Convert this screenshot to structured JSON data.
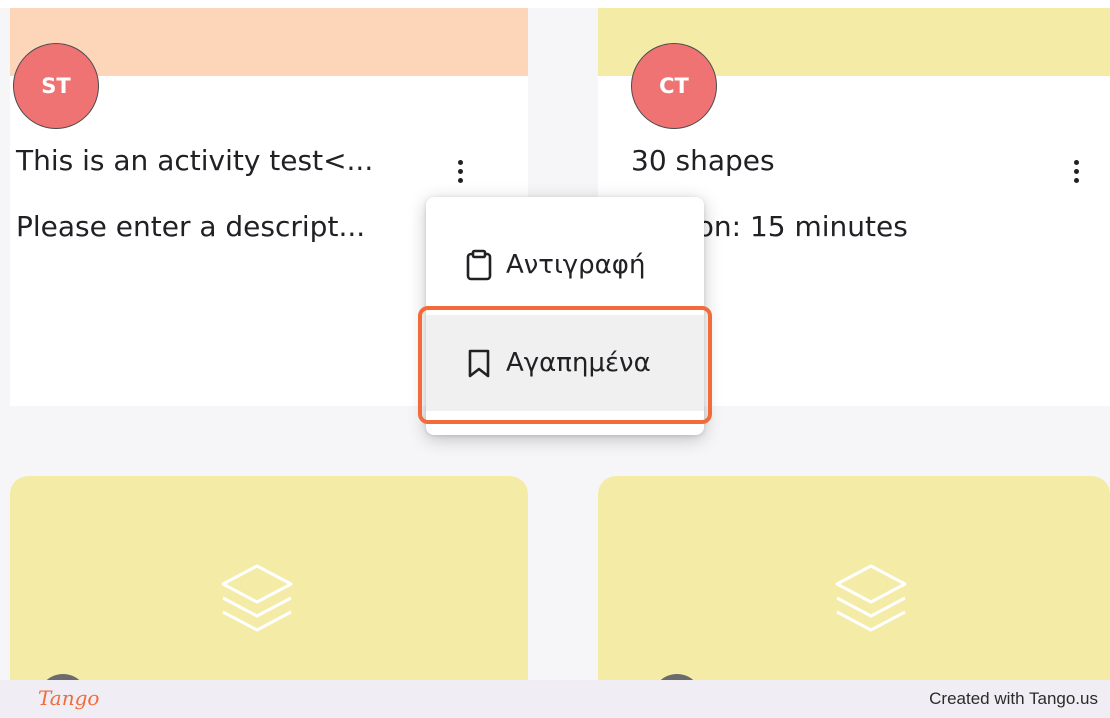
{
  "cards": [
    {
      "banner_color": "#fdd6ba",
      "avatar_initials": "ST",
      "avatar_color": "#f07373",
      "title": "This is an activity test<...",
      "description": "Please enter a descript..."
    },
    {
      "banner_color": "#f3eba6",
      "avatar_initials": "CT",
      "avatar_color": "#f07373",
      "title": "30 shapes",
      "description": "Duration: 15 minutes"
    },
    {
      "thumbnail_color": "#f3eba6",
      "thumbnail_icon": "layers-icon"
    },
    {
      "thumbnail_color": "#f3eba6",
      "thumbnail_icon": "layers-icon"
    }
  ],
  "context_menu": {
    "items": [
      {
        "label": "Αντιγραφή",
        "icon": "clipboard-icon"
      },
      {
        "label": "Αγαπημένα",
        "icon": "bookmark-icon",
        "highlighted": true
      }
    ],
    "highlight_color": "#f26b3a"
  },
  "footer": {
    "logo": "Tango",
    "logo_color": "#f26b3a",
    "text": "Created with Tango.us"
  }
}
